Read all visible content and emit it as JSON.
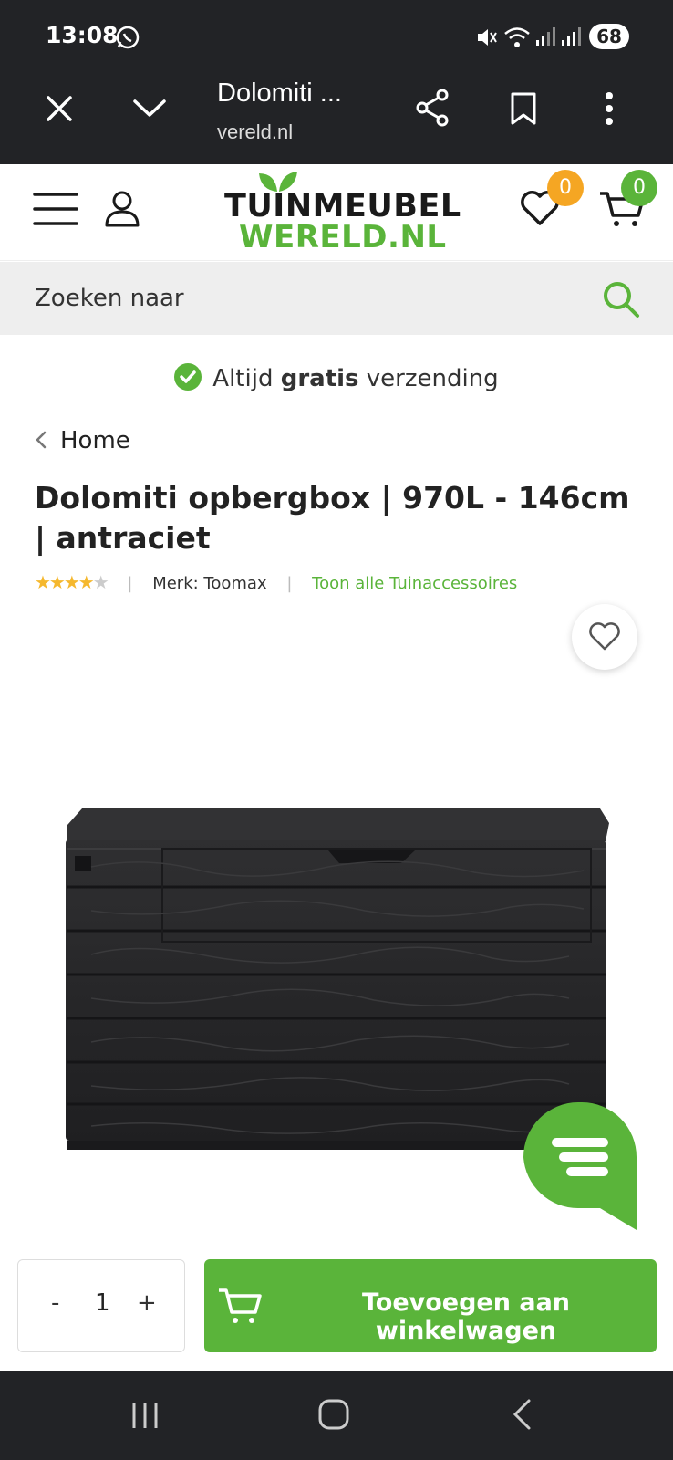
{
  "status": {
    "time": "13:08",
    "battery": "68"
  },
  "browser": {
    "title": "Dolomiti ...",
    "url": "vereld.nl"
  },
  "header": {
    "logo_line1": "TUINMEUBEL",
    "logo_line2": "WERELD.NL",
    "wishlist_count": "0",
    "cart_count": "0"
  },
  "search": {
    "placeholder": "Zoeken naar"
  },
  "shipping": {
    "prefix": "Altijd ",
    "bold": "gratis",
    "suffix": " verzending"
  },
  "breadcrumb": {
    "label": "Home"
  },
  "product": {
    "title": "Dolomiti opbergbox | 970L - 146cm | antraciet",
    "rating": 4,
    "rating_max": 5,
    "brand": "Merk: Toomax",
    "category_link": "Toon alle Tuinaccessoires"
  },
  "cart": {
    "qty_minus": "-",
    "qty_value": "1",
    "qty_plus": "+",
    "add_label": "Toevoegen aan winkelwagen"
  },
  "colors": {
    "brand_green": "#5ab43a",
    "badge_orange": "#f5a623",
    "dark_bar": "#222326"
  }
}
